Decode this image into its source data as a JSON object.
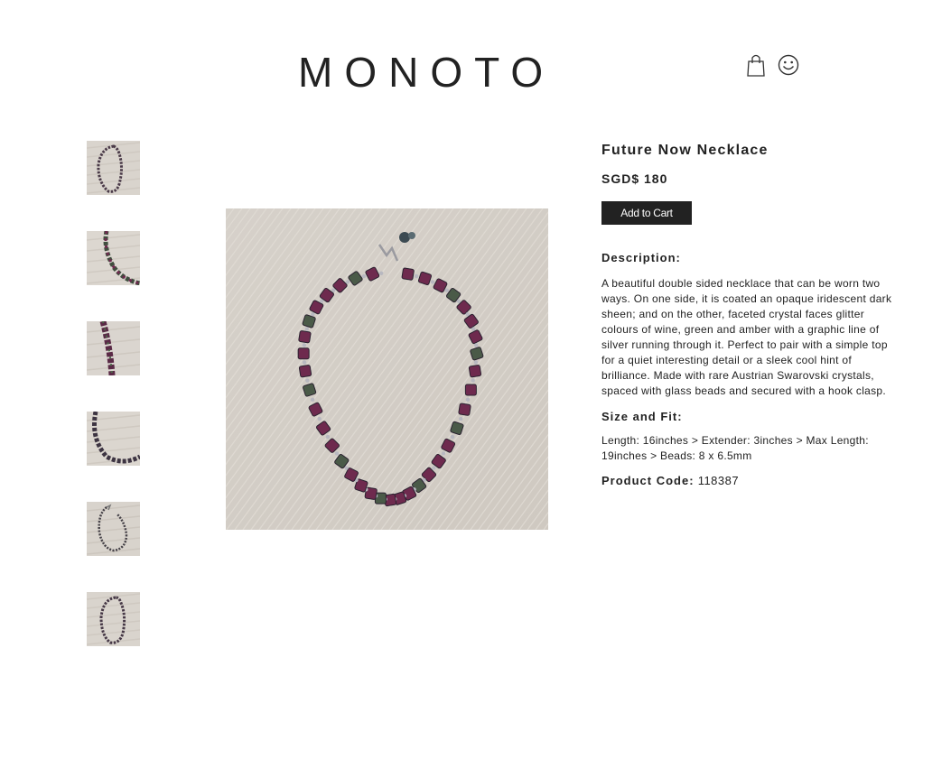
{
  "header": {
    "logo": "MONOTO",
    "icons": [
      "shopping-bag-icon",
      "smiley-account-icon"
    ]
  },
  "gallery": {
    "thumbnails": [
      {
        "alt": "necklace full view"
      },
      {
        "alt": "necklace bead close-up"
      },
      {
        "alt": "necklace beads detail"
      },
      {
        "alt": "necklace strand curve"
      },
      {
        "alt": "necklace with clasp"
      },
      {
        "alt": "necklace full view 2"
      }
    ]
  },
  "product": {
    "title": "Future Now Necklace",
    "price": "SGD$ 180",
    "add_to_cart": "Add to Cart",
    "description_label": "Description:",
    "description": "A beautiful double sided necklace that can be worn two ways. On one side, it is coated an opaque iridescent dark sheen; and on the other, faceted crystal faces glitter colours of wine, green and amber with a graphic line of silver running through it. Perfect to pair with a simple top for a quiet interesting detail or a sleek cool hint of brilliance. Made with rare Austrian Swarovski crystals, spaced with glass beads and secured with a hook clasp.",
    "size_label": "Size and Fit:",
    "size_text": "Length: 16inches > Extender: 3inches > Max Length: 19inches > Beads: 8 x 6.5mm",
    "code_label": "Product Code:",
    "code_value": "118387"
  },
  "colors": {
    "text": "#222222",
    "button_bg": "#222222",
    "button_text": "#ffffff",
    "photo_background": "#d8d3cc",
    "bead_wine": "#6e2a4e",
    "bead_green": "#4a5a48"
  }
}
